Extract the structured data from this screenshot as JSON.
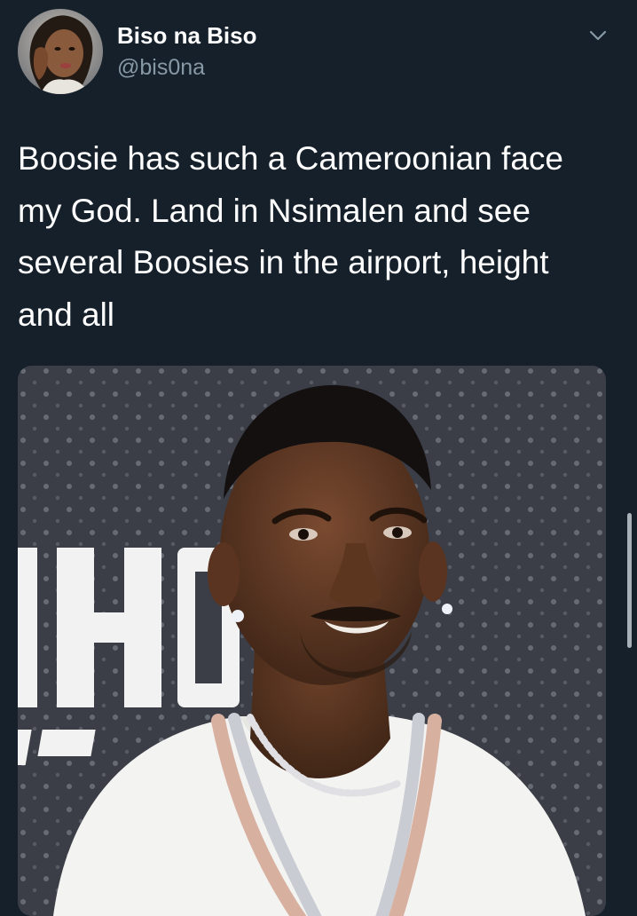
{
  "tweet": {
    "author": {
      "display_name": "Biso na Biso",
      "handle": "@bis0na",
      "avatar_icon": "profile-photo"
    },
    "menu_icon": "chevron-down-icon",
    "text": "Boosie has such a Cameroonian face my God. Land in Nsimalen and see several Boosies in the airport, height and all",
    "media": {
      "description_icon": "photo",
      "backdrop_text": "HO"
    }
  },
  "colors": {
    "background": "#15202b",
    "primary_text": "#ffffff",
    "secondary_text": "#8899a6",
    "backdrop": "#3b3e47"
  }
}
